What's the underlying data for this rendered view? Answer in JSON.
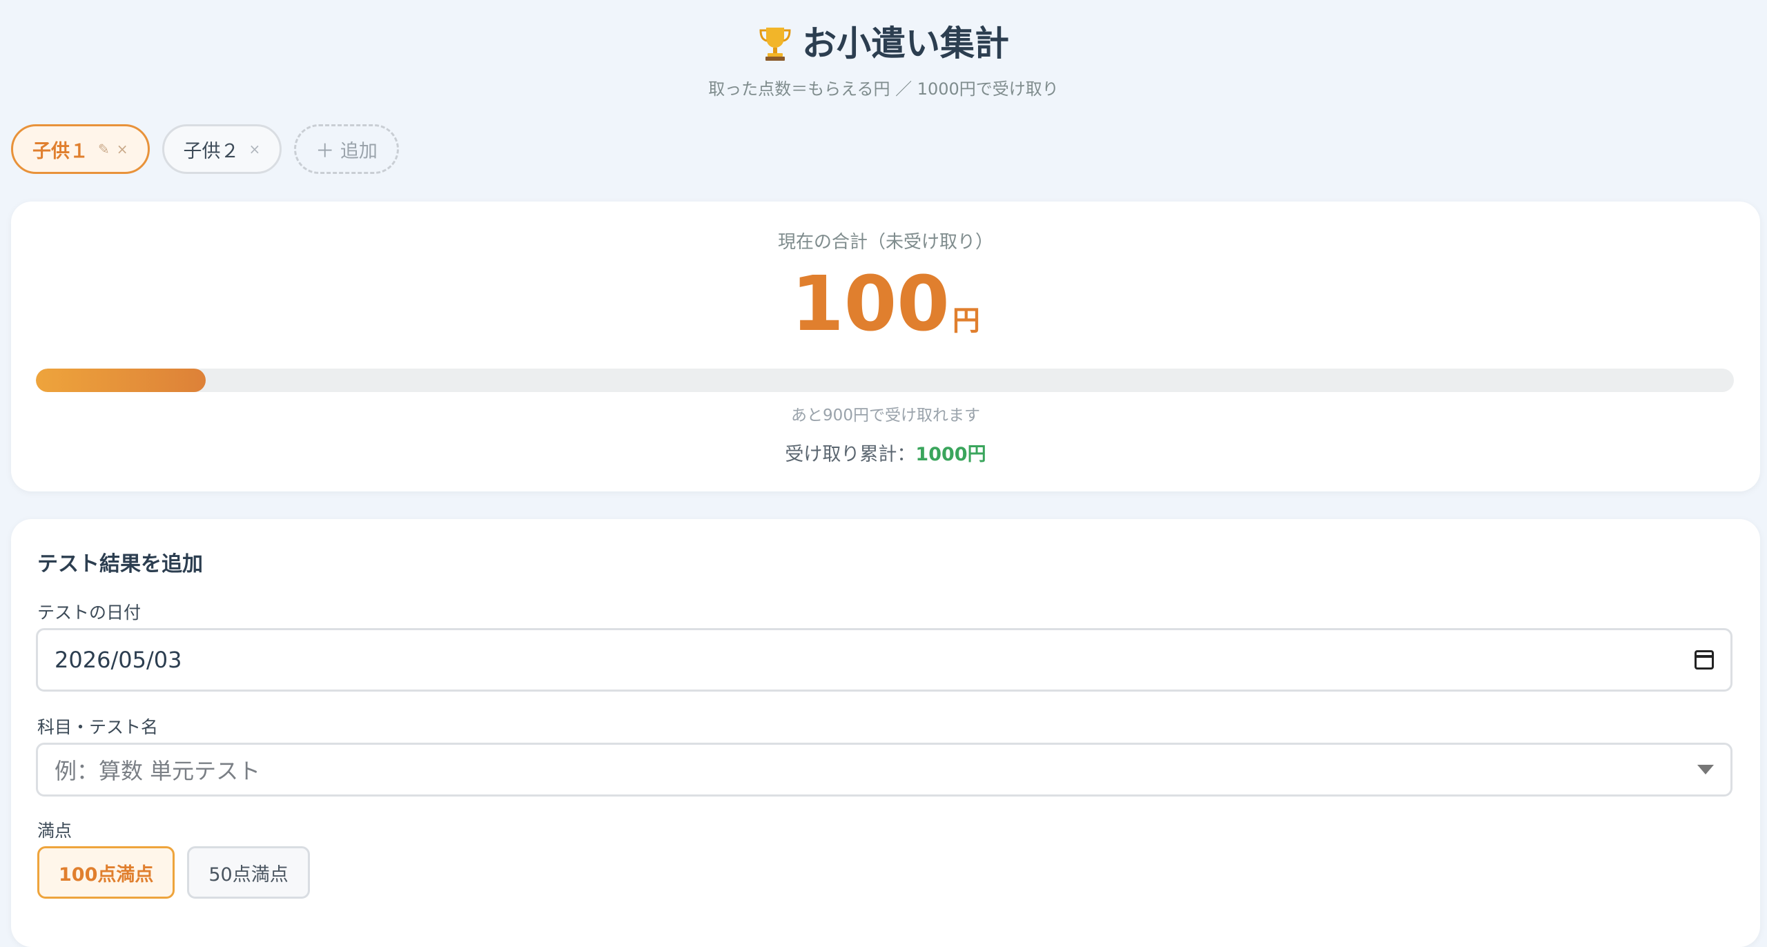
{
  "header": {
    "title": "お小遣い集計",
    "subtitle": "取った点数＝もらえる円 ／ 1000円で受け取り"
  },
  "tabs": {
    "items": [
      {
        "label": "子供１",
        "edit_icon": "✎",
        "close_icon": "×"
      },
      {
        "label": "子供２",
        "close_icon": "×"
      }
    ],
    "add_label": "＋ 追加"
  },
  "summary": {
    "label": "現在の合計（未受け取り）",
    "amount": "100",
    "unit": "円",
    "progress_fraction": 0.1,
    "remaining_text": "あと900円で受け取れます",
    "total_label": "受け取り累計：",
    "total_value": "1000円"
  },
  "form": {
    "title": "テスト結果を追加",
    "date_label": "テストの日付",
    "date_value": "2026/05/03",
    "subject_label": "科目・テスト名",
    "subject_placeholder": "例：算数 単元テスト",
    "fullscore_label": "満点",
    "fullscore_options": [
      "100点満点",
      "50点満点"
    ],
    "fullscore_selected": "100点満点"
  },
  "colors": {
    "accent": "#e07f2e",
    "success": "#3aa55c",
    "background": "#f0f5fb"
  },
  "icons": {
    "title": "trophy-icon",
    "edit": "pencil-icon",
    "close": "close-icon",
    "date": "calendar-icon",
    "select": "chevron-down-icon"
  }
}
